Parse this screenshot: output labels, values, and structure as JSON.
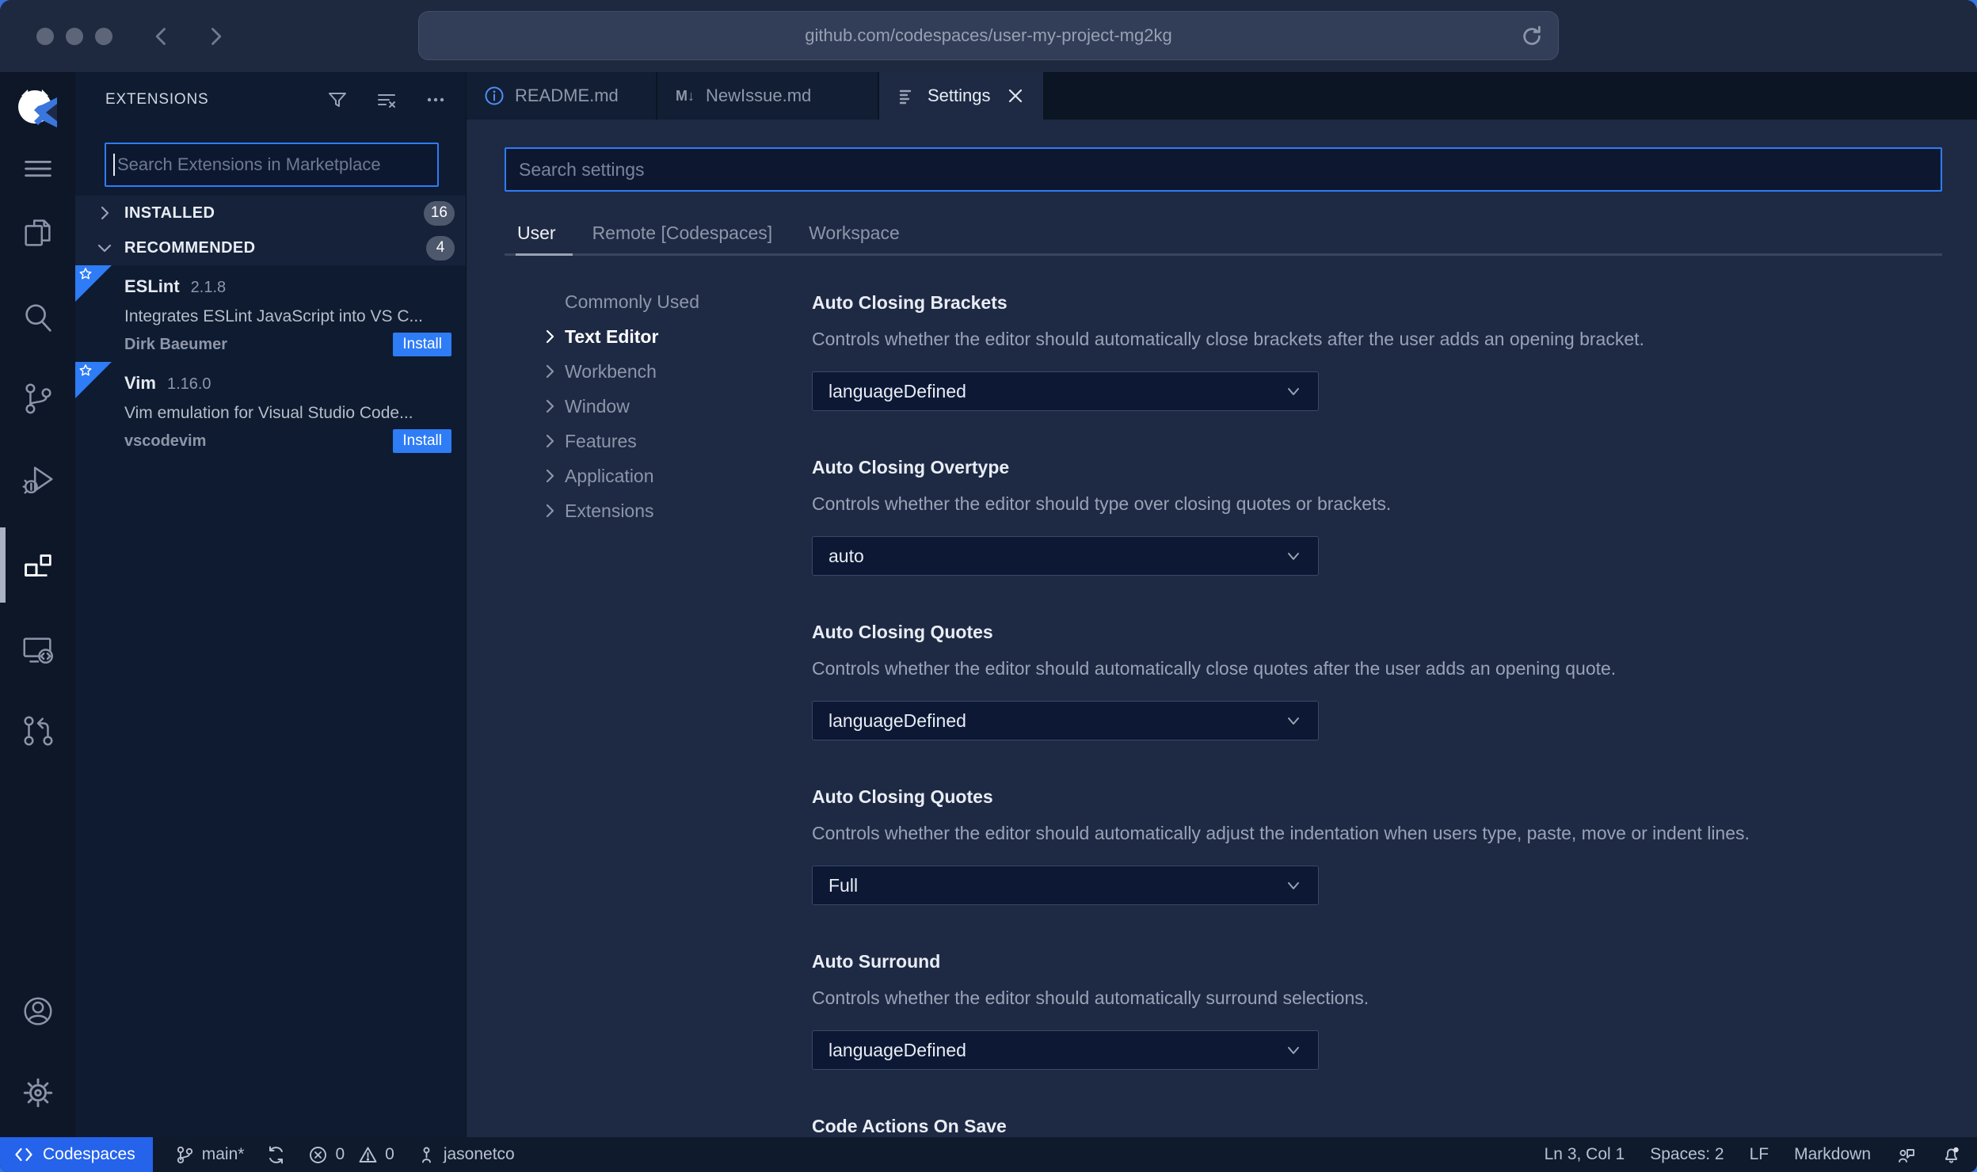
{
  "browser": {
    "url": "github.com/codespaces/user-my-project-mg2kg"
  },
  "sidebar": {
    "title": "EXTENSIONS",
    "search_placeholder": "Search Extensions in Marketplace",
    "sections": {
      "installed": {
        "label": "INSTALLED",
        "count": "16"
      },
      "recommended": {
        "label": "RECOMMENDED",
        "count": "4"
      }
    },
    "extensions": [
      {
        "name": "ESLint",
        "version": "2.1.8",
        "description": "Integrates ESLint JavaScript into VS C...",
        "publisher": "Dirk Baeumer",
        "action": "Install"
      },
      {
        "name": "Vim",
        "version": "1.16.0",
        "description": "Vim emulation for Visual Studio Code...",
        "publisher": "vscodevim",
        "action": "Install"
      }
    ]
  },
  "tabs": [
    {
      "label": "README.md"
    },
    {
      "label": "NewIssue.md",
      "icon_glyph": "M↓"
    },
    {
      "label": "Settings"
    }
  ],
  "settings": {
    "search_placeholder": "Search settings",
    "scopes": [
      "User",
      "Remote [Codespaces]",
      "Workspace"
    ],
    "active_scope": "User",
    "toc": [
      "Commonly Used",
      "Text Editor",
      "Workbench",
      "Window",
      "Features",
      "Application",
      "Extensions"
    ],
    "active_toc": "Text Editor",
    "rows": [
      {
        "title": "Auto Closing Brackets",
        "desc": "Controls whether the editor should automatically close brackets after the user adds an opening bracket.",
        "value": "languageDefined"
      },
      {
        "title": "Auto Closing Overtype",
        "desc": "Controls whether the editor should type over closing quotes or brackets.",
        "value": "auto"
      },
      {
        "title": "Auto Closing Quotes",
        "desc": "Controls whether the editor should automatically close quotes after the user adds an opening quote.",
        "value": "languageDefined"
      },
      {
        "title": "Auto Closing Quotes",
        "desc": "Controls whether the editor should automatically adjust the indentation when users type, paste, move or indent lines.",
        "value": "Full"
      },
      {
        "title": "Auto Surround",
        "desc": "Controls whether the editor should automatically surround selections.",
        "value": "languageDefined"
      },
      {
        "title": "Code Actions On Save"
      }
    ]
  },
  "status_bar": {
    "remote_label": "Codespaces",
    "branch": "main*",
    "errors": "0",
    "warnings": "0",
    "user": "jasonetco",
    "cursor": "Ln 3, Col 1",
    "indent": "Spaces: 2",
    "eol": "LF",
    "language": "Markdown"
  },
  "colors": {
    "accent_blue": "#2e7cf6",
    "remote_bg": "#2563eb",
    "editor_bg": "#1e2a44",
    "sidebar_bg": "#0f1b30"
  }
}
